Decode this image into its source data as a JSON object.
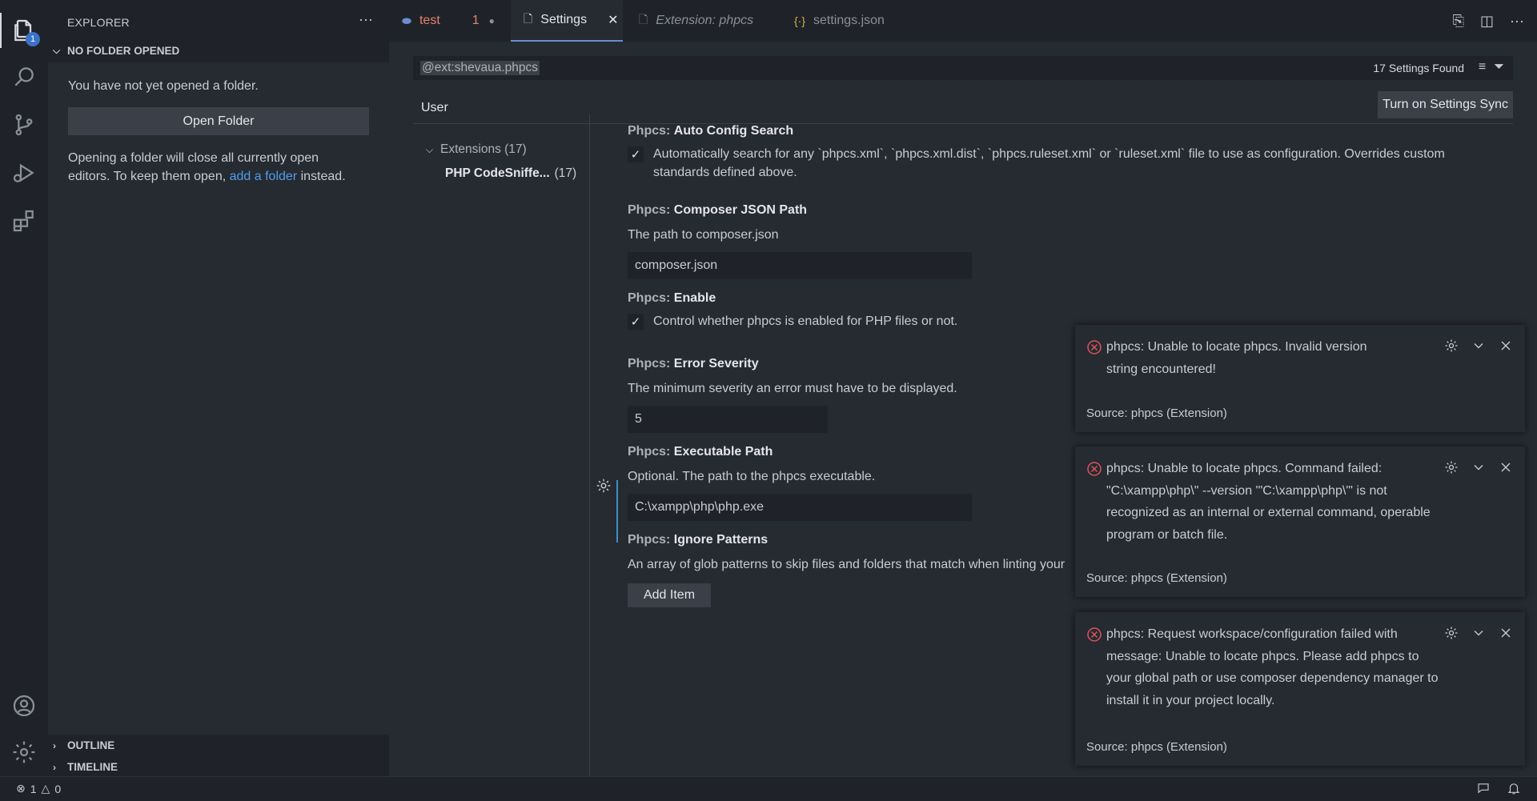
{
  "activity_bar": {
    "explorer_badge": "1",
    "icons": [
      "files-icon",
      "search-icon",
      "source-control-icon",
      "run-debug-icon",
      "extensions-icon",
      "account-icon",
      "gear-icon"
    ]
  },
  "sidebar": {
    "title": "EXPLORER",
    "more": "···",
    "section_title": "NO FOLDER OPENED",
    "message": "You have not yet opened a folder.",
    "open_folder_label": "Open Folder",
    "note_part1": "Opening a folder will close all currently open",
    "note_part2": "editors. To keep them open,",
    "note_link": "add a folder",
    "note_part3": "instead.",
    "outline_label": "OUTLINE",
    "timeline_label": "TIMELINE"
  },
  "tabs": [
    {
      "label": "test",
      "badge": "1",
      "color": "#e8806b"
    },
    {
      "label": "Settings"
    },
    {
      "label": "Extension: phpcs"
    },
    {
      "label": "settings.json"
    }
  ],
  "settings": {
    "search_value": "@ext:shevaua.phpcs",
    "found_count": "17 Settings Found",
    "user_tab": "User",
    "sync_label": "Turn on Settings Sync",
    "toc_extensions": "Extensions (17)",
    "toc_sub_label": "PHP CodeSniffe...",
    "toc_sub_count": "(17)",
    "category": "Phpcs:",
    "items": [
      {
        "name": "Auto Config Search",
        "checkbox_label": "Automatically search for any `phpcs.xml`, `phpcs.xml.dist`, `phpcs.ruleset.xml` or `ruleset.xml` file to use as configuration. Overrides custom standards defined above."
      },
      {
        "name": "Composer JSON Path",
        "desc": "The path to composer.json",
        "value": "composer.json"
      },
      {
        "name": "Enable",
        "checkbox_label": "Control whether phpcs is enabled for PHP files or not."
      },
      {
        "name": "Error Severity",
        "desc": "The minimum severity an error must have to be displayed.",
        "value": "5"
      },
      {
        "name": "Executable Path",
        "desc": "Optional. The path to the phpcs executable.",
        "value": "C:\\xampp\\php\\php.exe"
      },
      {
        "name": "Ignore Patterns",
        "desc": "An array of glob patterns to skip files and folders that match when linting your",
        "button": "Add Item"
      }
    ]
  },
  "notifications": [
    {
      "message": "phpcs: Unable to locate phpcs. Invalid version string encountered!",
      "source": "Source: phpcs (Extension)"
    },
    {
      "message": "phpcs: Unable to locate phpcs. Command failed: \"C:\\xampp\\php\\\" --version '\"C:\\xampp\\php\\\"' is not recognized as an internal or external command, operable program or batch file.",
      "source": "Source: phpcs (Extension)"
    },
    {
      "message": "phpcs: Request workspace/configuration failed with message: Unable to locate phpcs. Please add phpcs to your global path or use composer dependency manager to install it in your project locally.",
      "source": "Source: phpcs (Extension)"
    }
  ],
  "status_bar": {
    "errors": "1",
    "warnings": "0"
  }
}
